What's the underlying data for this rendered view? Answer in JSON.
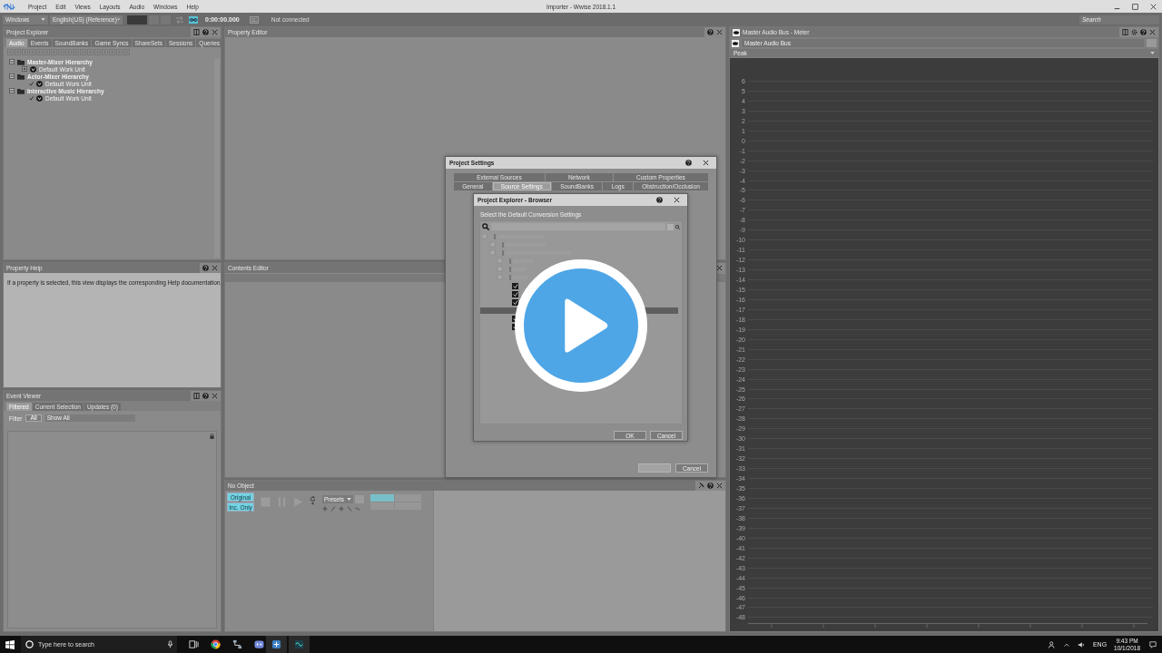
{
  "menu_bar": {
    "items": [
      "Project",
      "Edit",
      "Views",
      "Layouts",
      "Audio",
      "Windows",
      "Help"
    ],
    "title": "Importer - Wwise 2018.1.1"
  },
  "toolbar": {
    "platform": "Windows",
    "language": "English(US) (Reference)",
    "linked": true,
    "time": "0:00:00.000",
    "connection": "Not connected",
    "search": {
      "placeholder": "Search"
    }
  },
  "project_explorer": {
    "title": "Project Explorer",
    "tabs": [
      {
        "label": "Audio",
        "selected": true
      },
      {
        "label": "Events",
        "selected": false
      },
      {
        "label": "SoundBanks",
        "selected": false
      },
      {
        "label": "Game Syncs",
        "selected": false
      },
      {
        "label": "ShareSets",
        "selected": false
      },
      {
        "label": "Sessions",
        "selected": false
      },
      {
        "label": "Queries",
        "selected": false
      }
    ],
    "tree": [
      {
        "label": "Master-Mixer Hierarchy",
        "expanded": true,
        "children": [
          {
            "label": "Default Work Unit",
            "expandable": true
          }
        ]
      },
      {
        "label": "Actor-Mixer Hierarchy",
        "expanded": true,
        "children": [
          {
            "label": "Default Work Unit",
            "expandable": false
          }
        ]
      },
      {
        "label": "Interactive Music Hierarchy",
        "expanded": true,
        "children": [
          {
            "label": "Default Work Unit",
            "expandable": false
          }
        ]
      }
    ]
  },
  "property_editor": {
    "title": "Property Editor"
  },
  "property_help": {
    "title": "Property Help",
    "text": "If a property is selected, this view displays the corresponding Help documentation."
  },
  "event_viewer": {
    "title": "Event Viewer",
    "tabs": [
      {
        "label": "Filtered",
        "selected": true
      },
      {
        "label": "Current Selection",
        "selected": false
      },
      {
        "label": "Updates (0)",
        "selected": false
      }
    ],
    "filter": {
      "label": "Filter",
      "toggle": "All",
      "value": "Show All"
    }
  },
  "contents_editor": {
    "title": "Contents Editor"
  },
  "transport": {
    "title": "No Object",
    "toggles": [
      {
        "label": "Original",
        "on": true
      },
      {
        "label": "Inc. Only",
        "on": true
      }
    ],
    "preset": "Presets"
  },
  "meter": {
    "title": "Master Audio Bus - Meter",
    "bus": "Master Audio Bus",
    "mode": "Peak",
    "scale": [
      "6",
      "5",
      "4",
      "3",
      "2",
      "1",
      "0",
      "-1",
      "-2",
      "-3",
      "-4",
      "-5",
      "-6",
      "-7",
      "-8",
      "-9",
      "-10",
      "-11",
      "-12",
      "-13",
      "-14",
      "-15",
      "-16",
      "-17",
      "-18",
      "-19",
      "-20",
      "-21",
      "-22",
      "-23",
      "-24",
      "-25",
      "-26",
      "-27",
      "-28",
      "-29",
      "-30",
      "-31",
      "-32",
      "-33",
      "-34",
      "-35",
      "-36",
      "-37",
      "-38",
      "-39",
      "-40",
      "-41",
      "-42",
      "-43",
      "-44",
      "-45",
      "-46",
      "-47",
      "-48"
    ]
  },
  "project_settings": {
    "title": "Project Settings",
    "tab_rows": [
      [
        {
          "label": "External Sources",
          "selected": false
        },
        {
          "label": "Network",
          "selected": false
        },
        {
          "label": "Custom Properties",
          "selected": false
        }
      ],
      [
        {
          "label": "General",
          "selected": false
        },
        {
          "label": "Source Settings",
          "selected": true
        },
        {
          "label": "SoundBanks",
          "selected": false
        },
        {
          "label": "Logs",
          "selected": false
        },
        {
          "label": "Obstruction/Occlusion",
          "selected": false
        }
      ]
    ],
    "cancel": "Cancel"
  },
  "browser": {
    "title": "Project Explorer - Browser",
    "prompt": "Select the Default Conversion Settings",
    "buttons": [
      "OK",
      "Cancel"
    ]
  },
  "taskbar": {
    "search": {
      "placeholder": "Type here to search"
    },
    "language": "ENG",
    "time": "9:43 PM",
    "date": "10/1/2018"
  }
}
